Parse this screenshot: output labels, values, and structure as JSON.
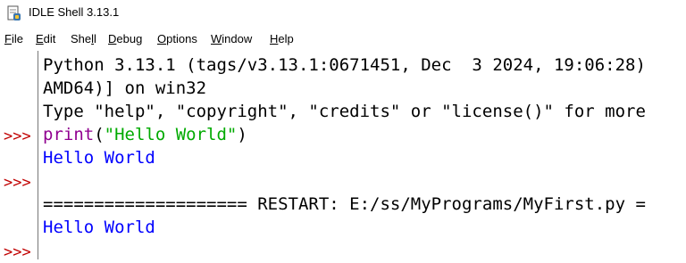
{
  "window": {
    "title": "IDLE Shell 3.13.1"
  },
  "menu": [
    {
      "pre": "",
      "u": "F",
      "post": "ile"
    },
    {
      "pre": "",
      "u": "E",
      "post": "dit"
    },
    {
      "pre": "She",
      "u": "l",
      "post": "l"
    },
    {
      "pre": "",
      "u": "D",
      "post": "ebug"
    },
    {
      "pre": "",
      "u": "O",
      "post": "ptions"
    },
    {
      "pre": "",
      "u": "W",
      "post": "indow"
    },
    {
      "pre": "",
      "u": "H",
      "post": "elp"
    }
  ],
  "shell": {
    "prompt": ">>>",
    "banner_line1": "Python 3.13.1 (tags/v3.13.1:0671451, Dec  3 2024, 19:06:28)",
    "banner_line2": "AMD64)] on win32",
    "banner_line3": "Type \"help\", \"copyright\", \"credits\" or \"license()\" for more",
    "cmd_func": "print",
    "cmd_open": "(",
    "cmd_string": "\"Hello World\"",
    "cmd_close": ")",
    "output1": "Hello World",
    "restart_line": "==================== RESTART: E:/ss/MyPrograms/MyFirst.py =",
    "output2": "Hello World"
  },
  "colors": {
    "prompt": "#c00000",
    "output": "#0000ff",
    "builtin": "#900090",
    "string": "#00aa00"
  }
}
